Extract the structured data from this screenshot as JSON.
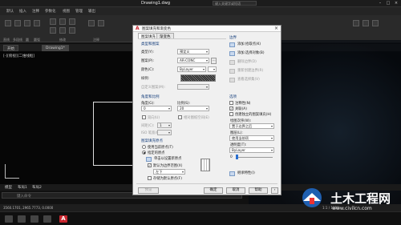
{
  "app": {
    "document_title": "Drawing1.dwg",
    "search_placeholder": "键入关键字或短语",
    "ribbon_tabs": [
      "默认",
      "插入",
      "注释",
      "参数化",
      "视图",
      "管理",
      "输出"
    ],
    "ribbon_groups": [
      "直线",
      "多段线",
      "圆",
      "圆弧",
      "绘图",
      "修改",
      "注释"
    ],
    "document_tabs": [
      "开始",
      "Drawing1*"
    ],
    "viewport_label": "[-][俯视][二维线框]",
    "layout_tabs": [
      "模型",
      "布局1",
      "布局2"
    ],
    "command_placeholder": "键入命令",
    "coordinates": "3560.1701, 2965.7773, 0.0000",
    "zoom": "1:1 / 100%"
  },
  "dialog": {
    "title": "图案填充和渐变色",
    "close_glyph": "×",
    "tabs": [
      "图案填充",
      "渐变色"
    ],
    "type_pattern": {
      "group": "类型和图案",
      "type_label": "类型(Y):",
      "type_value": "预定义",
      "pattern_label": "图案(P):",
      "pattern_value": "AR-CONC",
      "color_label": "颜色(C):",
      "color_value": "ByLayer",
      "sample_label": "样例:",
      "custom_label": "自定义图案(M):"
    },
    "angle_scale": {
      "group": "角度和比例",
      "angle_label": "角度(G):",
      "angle_value": "0",
      "scale_label": "比例(S):",
      "scale_value": "20",
      "double_label": "双向(U)",
      "relative_label": "相对图纸空间(E)",
      "spacing_label": "间距(C):",
      "spacing_value": "1",
      "iso_label": "ISO 笔宽(O):"
    },
    "origin": {
      "group": "图案填充原点",
      "current_label": "使用当前原点(T)",
      "specified_label": "指定的原点",
      "click_label": "单击以设置新原点",
      "default_extents_label": "默认为边界范围(X)",
      "position_value": "左下",
      "store_label": "存储为默认原点(F)"
    },
    "boundaries": {
      "group": "边界",
      "pick_points": "添加:拾取点(K)",
      "select_objects": "添加:选择对象(B)",
      "remove": "删除边界(D)",
      "recreate": "重新创建边界(R)",
      "view_selections": "查看选择集(V)"
    },
    "options": {
      "group": "选项",
      "annotative": "注释性(N)",
      "associative": "关联(A)",
      "separate": "创建独立的图案填充(H)",
      "draw_order_label": "绘图次序(W):",
      "draw_order_value": "置于边界之后",
      "layer_label": "图层(L):",
      "layer_value": "使用当前项",
      "transparency_label": "透明度(T):",
      "transparency_value": "ByLayer",
      "transparency_number": "0"
    },
    "inherit_label": "继承特性(I)",
    "buttons": {
      "preview": "预览",
      "ok": "确定",
      "cancel": "取消",
      "help": "帮助"
    }
  },
  "watermark": {
    "brand": "土木工程网",
    "url": "www.civilcn.com"
  }
}
